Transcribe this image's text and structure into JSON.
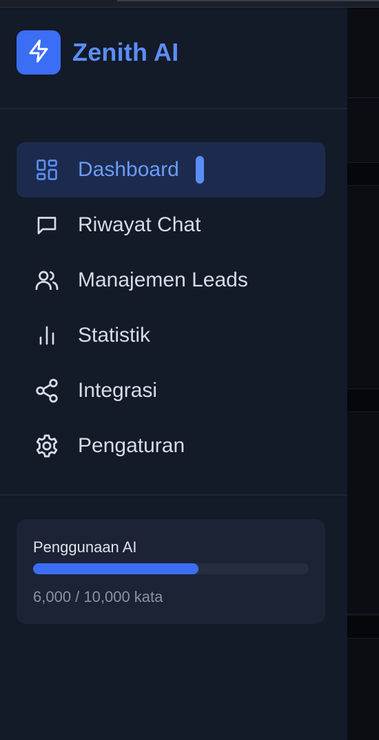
{
  "brand": {
    "name": "Zenith AI",
    "logo_icon": "lightning-bolt-icon",
    "accent_color": "#3b6ef5"
  },
  "nav": {
    "items": [
      {
        "label": "Dashboard",
        "icon": "dashboard-grid-icon",
        "active": true
      },
      {
        "label": "Riwayat Chat",
        "icon": "chat-bubble-icon",
        "active": false
      },
      {
        "label": "Manajemen Leads",
        "icon": "users-icon",
        "active": false
      },
      {
        "label": "Statistik",
        "icon": "bar-chart-icon",
        "active": false
      },
      {
        "label": "Integrasi",
        "icon": "share-nodes-icon",
        "active": false
      },
      {
        "label": "Pengaturan",
        "icon": "gear-icon",
        "active": false
      }
    ]
  },
  "usage": {
    "title": "Penggunaan AI",
    "text": "6,000 / 10,000 kata",
    "used": 6000,
    "limit": 10000,
    "progress_fraction": 0.6
  }
}
